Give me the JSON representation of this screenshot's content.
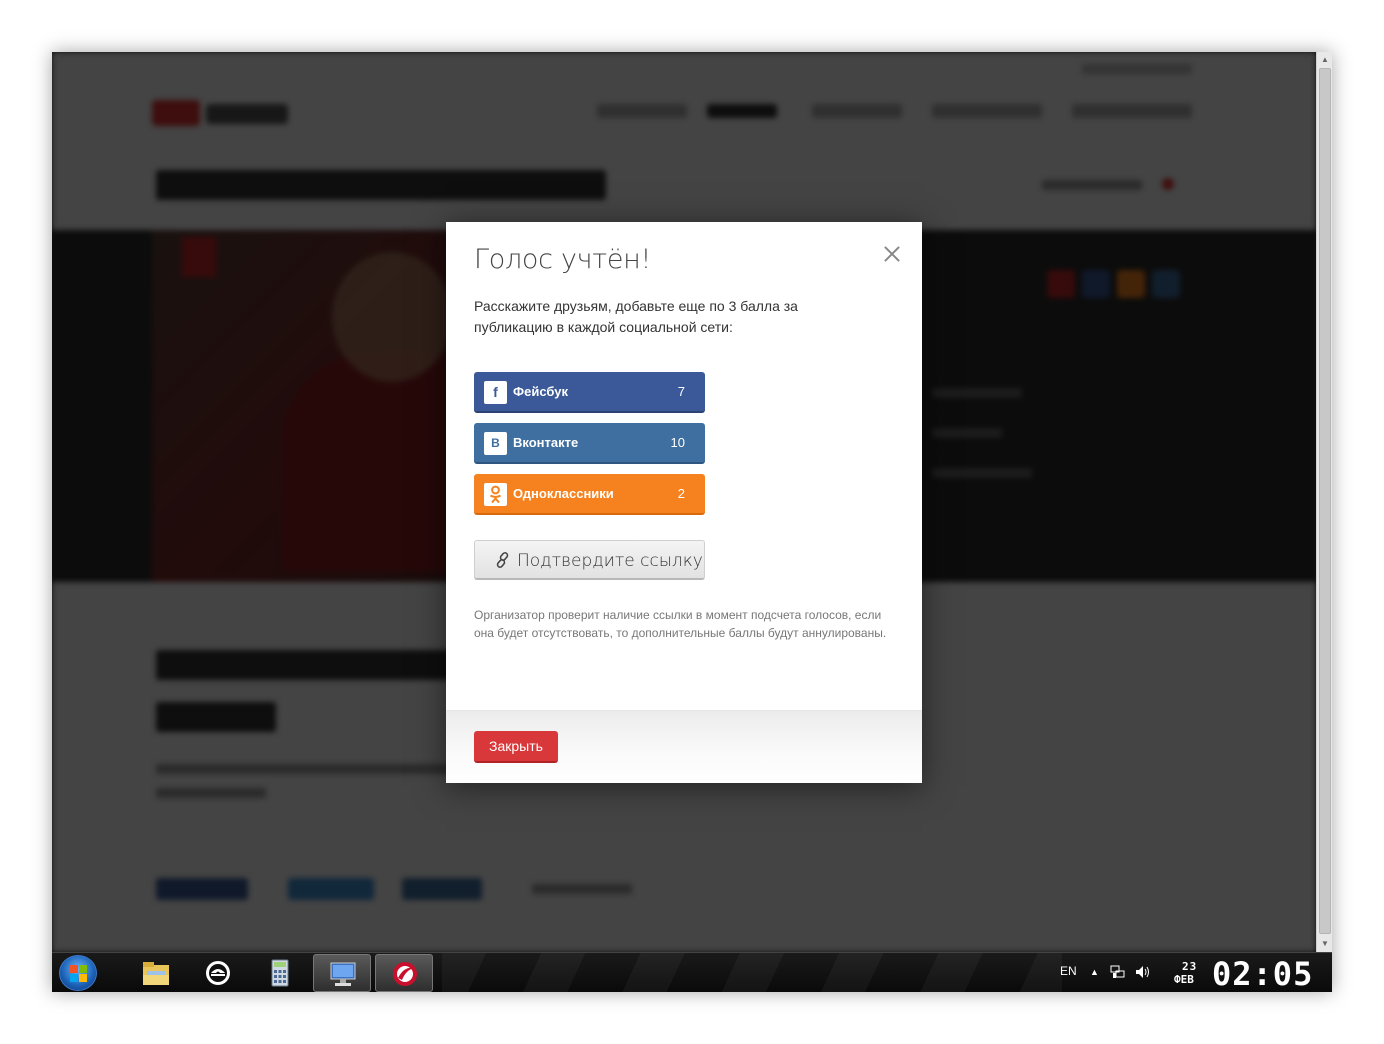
{
  "modal": {
    "title": "Голос учтён!",
    "description": "Расскажите друзьям, добавьте еще по 3 балла за публикацию в каждой социальной сети:",
    "social": [
      {
        "name": "Фейсбук",
        "count": "7",
        "icon": "facebook-icon",
        "glyph": "f",
        "color": "#3b5998"
      },
      {
        "name": "Вконтакте",
        "count": "10",
        "icon": "vk-icon",
        "glyph": "B",
        "color": "#3f6fa0"
      },
      {
        "name": "Одноклассники",
        "count": "2",
        "icon": "odnoklassniki-icon",
        "glyph": "ок",
        "color": "#f5821f"
      }
    ],
    "confirm_label": "Подтвердите ссылку",
    "note": "Организатор проверит наличие ссылки в момент подсчета голосов, если она будет отсутствовать, то дополнительные баллы будут аннулированы.",
    "close_label": "Закрыть"
  },
  "taskbar": {
    "lang": "EN",
    "date_day": "23",
    "date_month": "ФЕВ",
    "time": "02:05"
  }
}
